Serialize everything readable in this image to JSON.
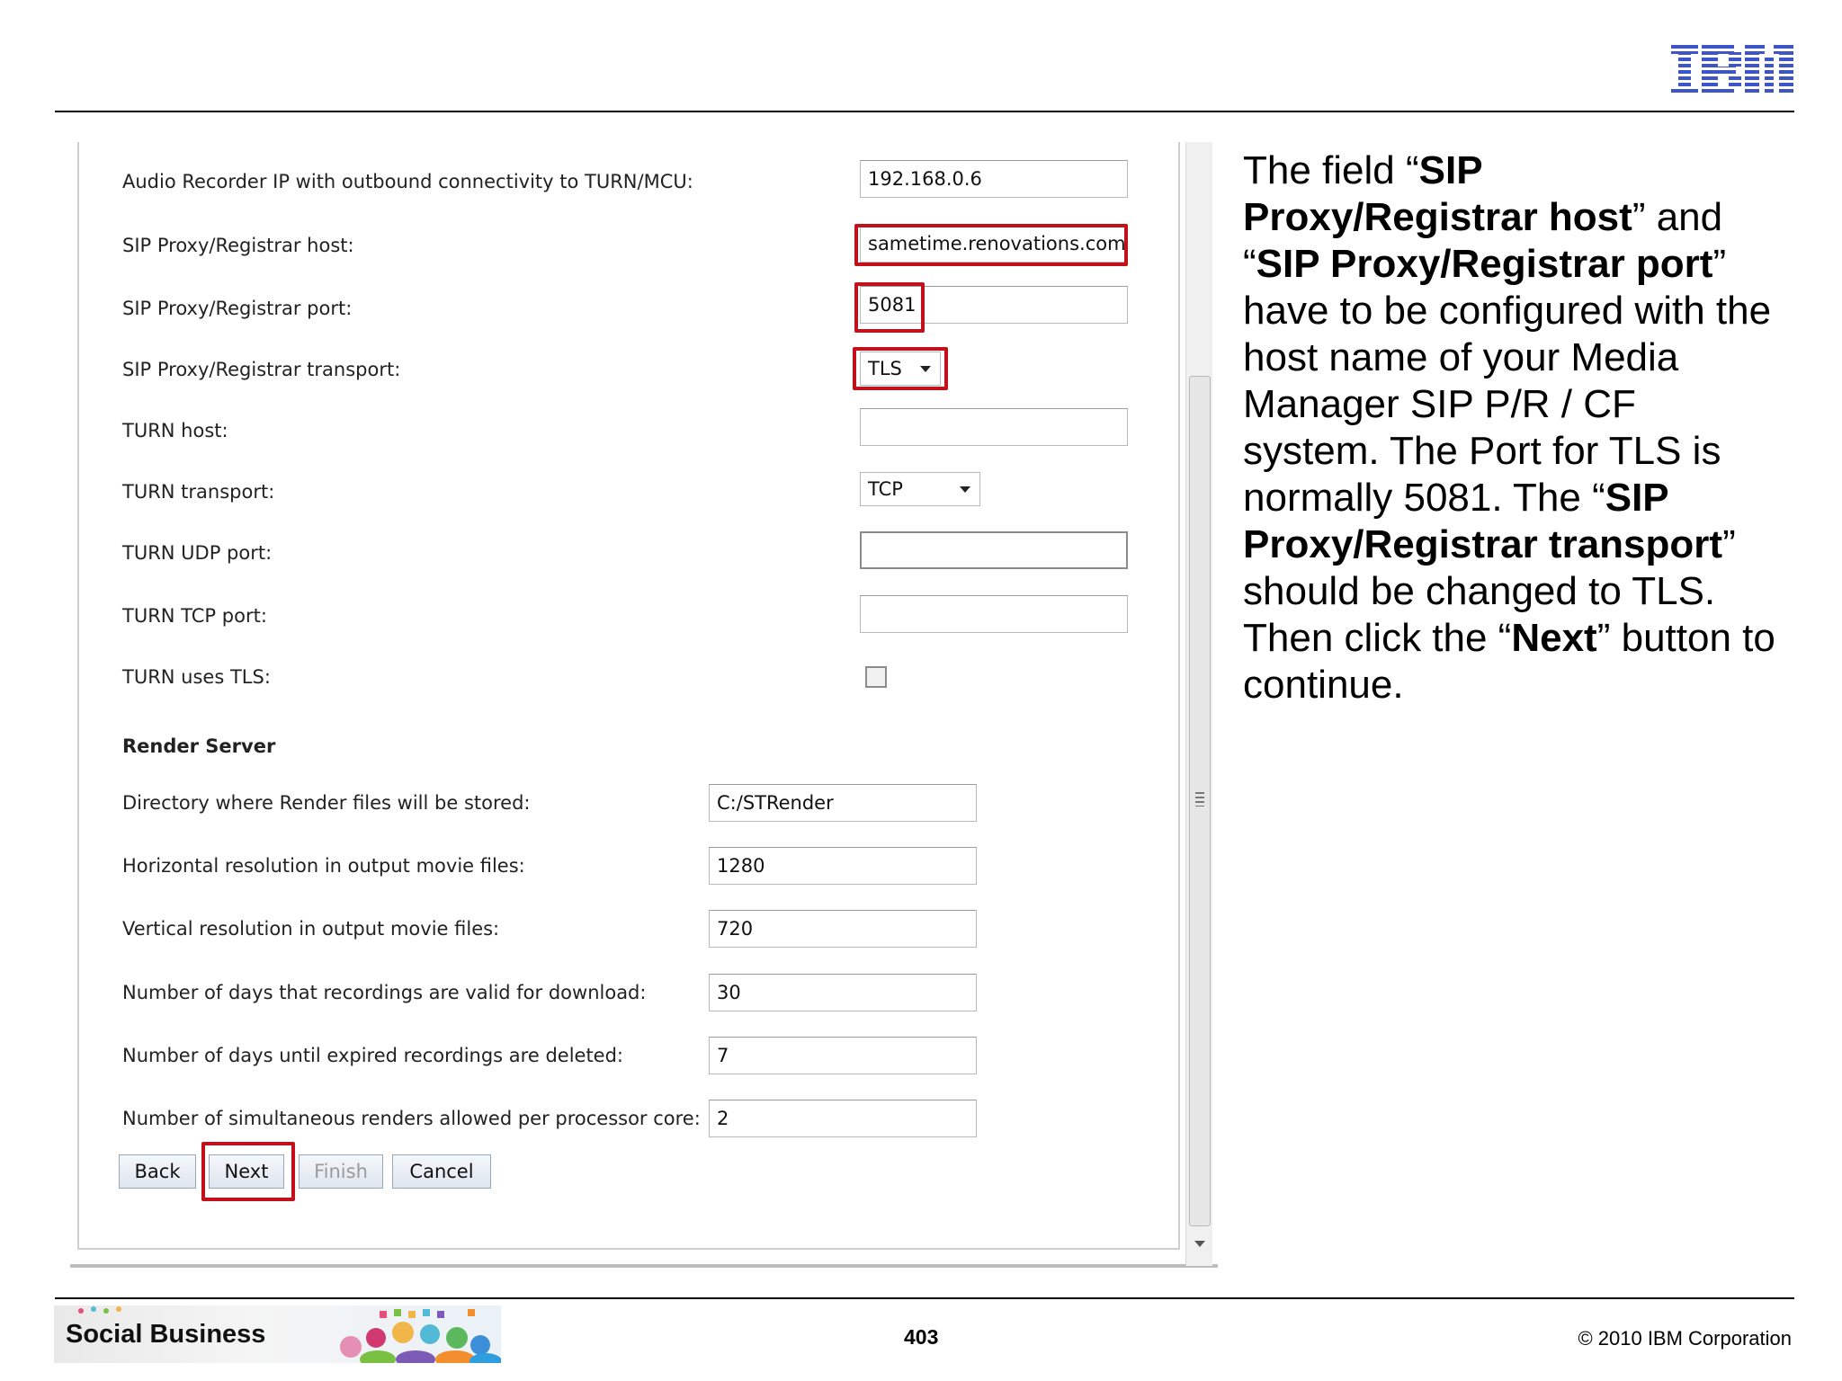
{
  "header": {
    "logo_text": "IBM"
  },
  "form": {
    "rows": [
      {
        "label": "Audio Recorder IP with outbound connectivity to TURN/MCU:",
        "value": "192.168.0.6"
      },
      {
        "label": "SIP Proxy/Registrar host:",
        "value": "sametime.renovations.com"
      },
      {
        "label": "SIP Proxy/Registrar port:",
        "value": "5081"
      },
      {
        "label": "SIP Proxy/Registrar transport:",
        "value": "TLS"
      },
      {
        "label": "TURN host:",
        "value": ""
      },
      {
        "label": "TURN transport:",
        "value": "TCP"
      },
      {
        "label": "TURN UDP port:",
        "value": ""
      },
      {
        "label": "TURN TCP port:",
        "value": ""
      },
      {
        "label": "TURN uses TLS:",
        "checked": false
      }
    ],
    "render_section": {
      "heading": "Render Server",
      "rows": [
        {
          "label": "Directory where Render files will be stored:",
          "value": "C:/STRender"
        },
        {
          "label": "Horizontal resolution in output movie files:",
          "value": "1280"
        },
        {
          "label": "Vertical resolution in output movie files:",
          "value": "720"
        },
        {
          "label": "Number of days that recordings are valid for download:",
          "value": "30"
        },
        {
          "label": "Number of days until expired recordings are deleted:",
          "value": "7"
        },
        {
          "label": "Number of simultaneous renders allowed per processor core:",
          "value": "2"
        }
      ]
    },
    "buttons": {
      "back": "Back",
      "next": "Next",
      "finish": "Finish",
      "cancel": "Cancel"
    }
  },
  "explanation": {
    "t1": "The field “",
    "b1": "SIP Proxy/Registrar host",
    "t2": "” and “",
    "b2": "SIP Proxy/Registrar port",
    "t3": "” have to be configured with the host name of your Media Manager SIP P/R / CF system. The Port for TLS is normally 5081. The “",
    "b3": "SIP Proxy/Registrar transport",
    "t4": "” should be changed to TLS. Then click the “",
    "b4": "Next",
    "t5": "” button to continue."
  },
  "footer": {
    "banner_text": "Social Business",
    "page_number": "403",
    "copyright": "© 2010 IBM Corporation"
  },
  "colors": {
    "highlight": "#c2111b",
    "ibm_blue": "#3d55c5"
  }
}
